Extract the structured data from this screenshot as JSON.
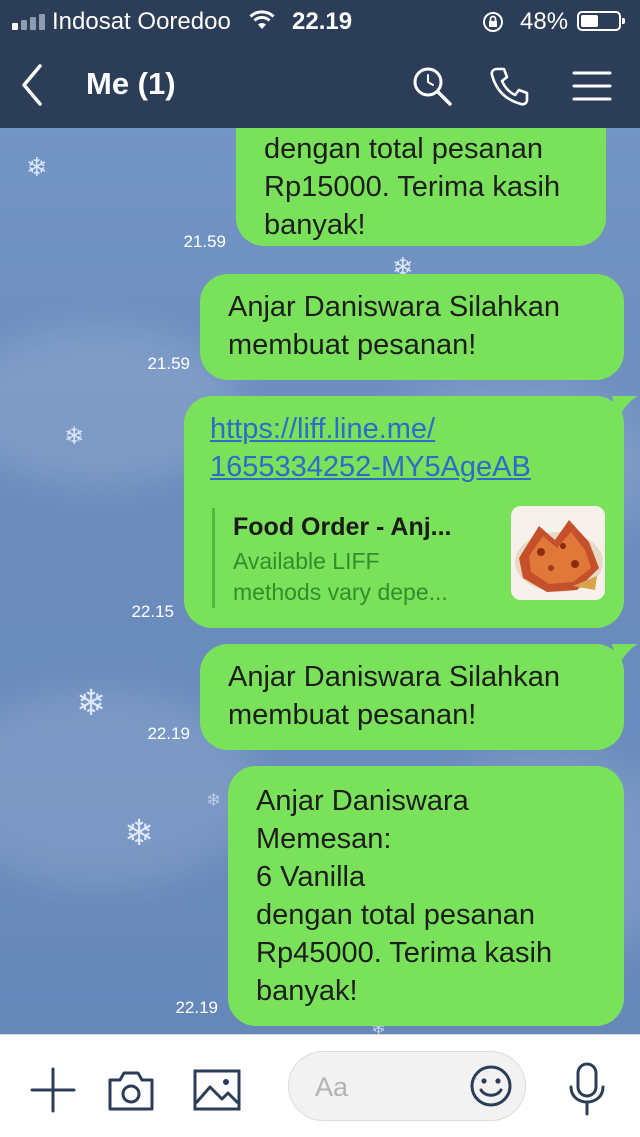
{
  "status_bar": {
    "carrier": "Indosat Ooredoo",
    "time": "22.19",
    "battery_percent": "48%",
    "battery_level": 0.48,
    "signal_bars": 4,
    "signal_active": 1
  },
  "header": {
    "title": "Me (1)",
    "icons": [
      "back-icon",
      "search-icon",
      "phone-icon",
      "menu-icon"
    ]
  },
  "messages": [
    {
      "time": "21.59",
      "text": "dengan total pesanan\nRp15000. Terima kasih\nbanyak!"
    },
    {
      "time": "21.59",
      "text": "Anjar Daniswara Silahkan\nmembuat pesanan!"
    },
    {
      "time": "22.15",
      "link_line1": "https://liff.line.me/",
      "link_line2": "1655334252-MY5AgeAB",
      "preview_title": "Food Order - Anj...",
      "preview_desc": "Available LIFF\nmethods vary depe..."
    },
    {
      "time": "22.19",
      "text": "Anjar Daniswara Silahkan\nmembuat pesanan!"
    },
    {
      "time": "22.19",
      "text": "Anjar Daniswara\nMemesan:\n6 Vanilla\ndengan total pesanan\nRp45000. Terima kasih\nbanyak!"
    }
  ],
  "input_bar": {
    "placeholder": "Aa",
    "icons": [
      "plus-icon",
      "camera-icon",
      "image-icon",
      "emoji-icon",
      "microphone-icon"
    ]
  },
  "colors": {
    "header_bg": "#2c3d57",
    "bubble_bg": "#7ae25a",
    "chat_bg": "#6f8fbf",
    "link": "#2f6bc7"
  }
}
